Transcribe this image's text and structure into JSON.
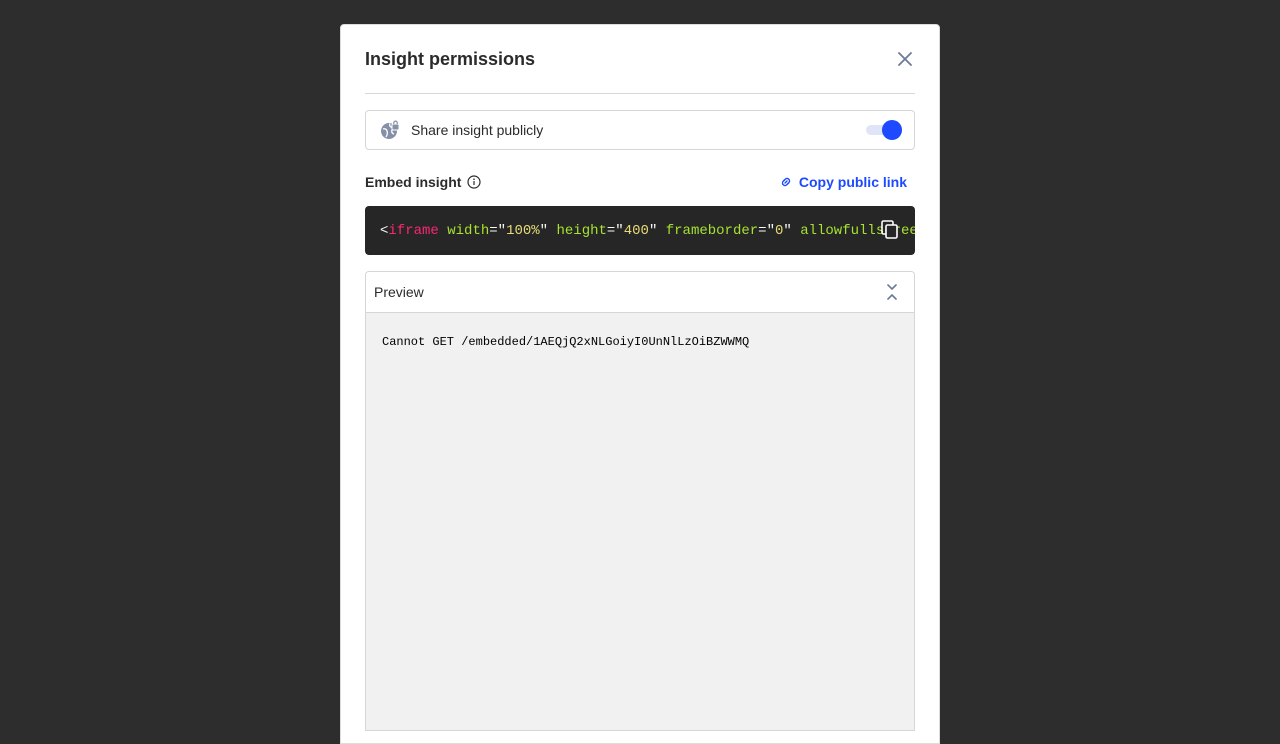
{
  "modal": {
    "title": "Insight permissions"
  },
  "share": {
    "label": "Share insight publicly",
    "enabled": true
  },
  "embed": {
    "title": "Embed insight",
    "copy_link_label": "Copy public link",
    "code": {
      "lt": "<",
      "tag": "iframe",
      "attr1": "width",
      "eq1": "=\"",
      "val1": "100%",
      "q1": "\" ",
      "attr2": "height",
      "eq2": "=\"",
      "val2": "400",
      "q2": "\" ",
      "attr3": "frameborder",
      "eq3": "=\"",
      "val3": "0",
      "q3": "\" ",
      "attr4": "allowfullscreen"
    }
  },
  "preview": {
    "label": "Preview",
    "error_text": "Cannot GET /embedded/1AEQjQ2xNLGoiyI0UnNlLzOiBZWWMQ"
  },
  "colors": {
    "accent": "#1d4aff",
    "backdrop": "#2d2d2d",
    "code_bg": "#262626"
  },
  "icons": {
    "close": "close-icon",
    "globe": "globe-lock-icon",
    "info": "info-icon",
    "link": "link-icon",
    "copy": "copy-icon",
    "collapse": "collapse-icon"
  }
}
